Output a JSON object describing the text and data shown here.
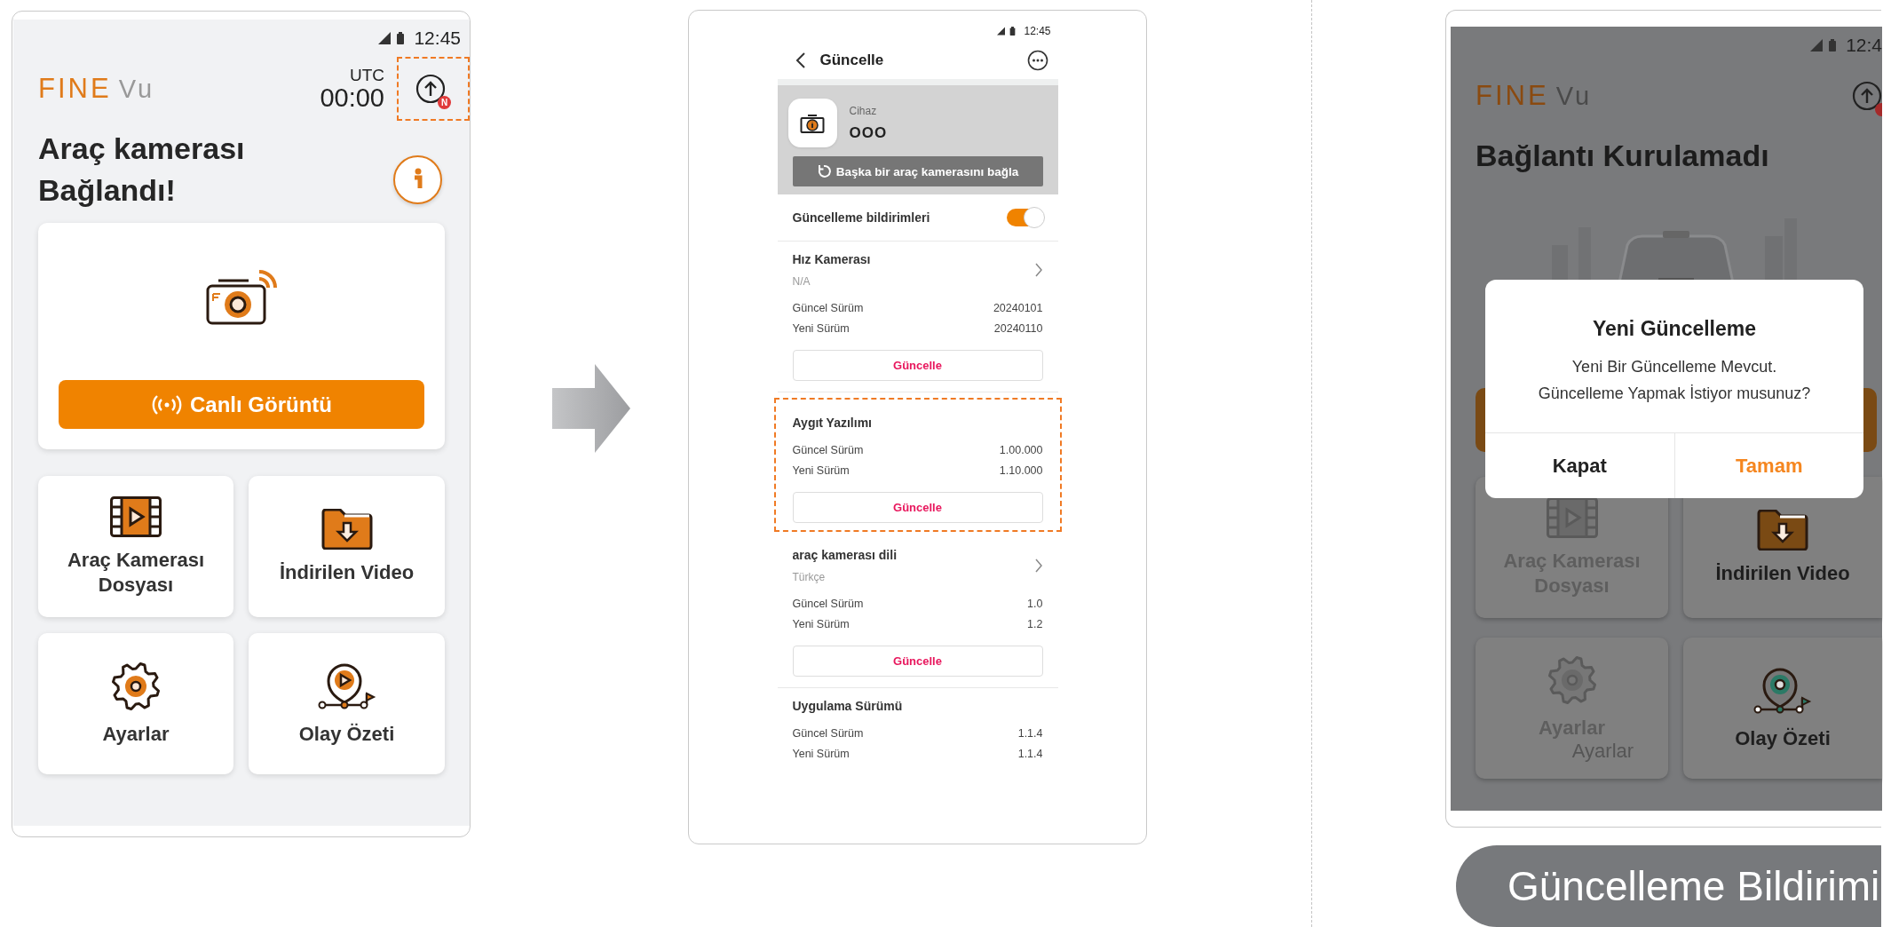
{
  "home_screen": {
    "status_time": "12:45",
    "logo": {
      "main": "FINE",
      "sub": "Vu"
    },
    "utc_label": "UTC",
    "utc_time": "00:00",
    "update_badge": "N",
    "update_highlighted": true,
    "title_lines": [
      "Araç kamerası",
      "Bağlandı!"
    ],
    "live_button": "Canlı Görüntü",
    "tiles": [
      {
        "kind": "film",
        "label_lines": [
          "Araç Kamerası",
          "Dosyası"
        ]
      },
      {
        "kind": "folder",
        "label_lines": [
          "İndirilen Video"
        ]
      },
      {
        "kind": "gear",
        "label_lines": [
          "Ayarlar"
        ]
      },
      {
        "kind": "event",
        "label_lines": [
          "Olay Özeti"
        ]
      }
    ]
  },
  "update_screen": {
    "status_time": "12:45",
    "title": "Güncelle",
    "device": {
      "label": "Cihaz",
      "name": "OOO",
      "reconnect_button": "Başka bir araç kamerasını bağla"
    },
    "notifications": {
      "label": "Güncelleme bildirimleri",
      "on": true
    },
    "sections": [
      {
        "title": "Hız Kamerası",
        "subtitle": "N/A",
        "opens_detail": true,
        "highlighted": false,
        "rows": [
          {
            "label": "Güncel Sürüm",
            "value": "20240101"
          },
          {
            "label": "Yeni Sürüm",
            "value": "20240110"
          }
        ],
        "button": "Güncelle"
      },
      {
        "title": "Aygıt Yazılımı",
        "opens_detail": false,
        "highlighted": true,
        "rows": [
          {
            "label": "Güncel Sürüm",
            "value": "1.00.000"
          },
          {
            "label": "Yeni Sürüm",
            "value": "1.10.000"
          }
        ],
        "button": "Güncelle"
      },
      {
        "title": "araç kamerası dili",
        "subtitle": "Türkçe",
        "opens_detail": true,
        "highlighted": false,
        "rows": [
          {
            "label": "Güncel Sürüm",
            "value": "1.0"
          },
          {
            "label": "Yeni Sürüm",
            "value": "1.2"
          }
        ],
        "button": "Güncelle"
      },
      {
        "title": "Uygulama Sürümü",
        "opens_detail": false,
        "highlighted": false,
        "rows": [
          {
            "label": "Güncel Sürüm",
            "value": "1.1.4"
          },
          {
            "label": "Yeni Sürüm",
            "value": "1.1.4"
          }
        ]
      }
    ]
  },
  "dialog_screen": {
    "status_time": "12:4",
    "logo": {
      "main": "FINE",
      "sub": "Vu"
    },
    "title_lines": [
      "Bağlantı Kurulamadı"
    ],
    "tiles": [
      {
        "kind": "film",
        "label_lines": [
          "Araç Kamerası",
          "Dosyası"
        ],
        "dimmed": true
      },
      {
        "kind": "folder",
        "label_lines": [
          "İndirilen Video"
        ],
        "dimmed": false
      },
      {
        "kind": "gear",
        "label_lines": [
          "Ayarlar"
        ],
        "dimmed": true,
        "extra_label": "Ayarlar"
      },
      {
        "kind": "event",
        "label_lines": [
          "Olay Özeti"
        ],
        "dimmed": false
      }
    ],
    "dialog": {
      "title": "Yeni Güncelleme",
      "message_lines": [
        "Yeni Bir Güncelleme Mevcut.",
        "Güncelleme Yapmak İstiyor musunuz?"
      ],
      "buttons": [
        {
          "label": "Kapat",
          "primary": false
        },
        {
          "label": "Tamam",
          "primary": true
        }
      ]
    }
  },
  "caption": "Güncelleme Bildirimi"
}
